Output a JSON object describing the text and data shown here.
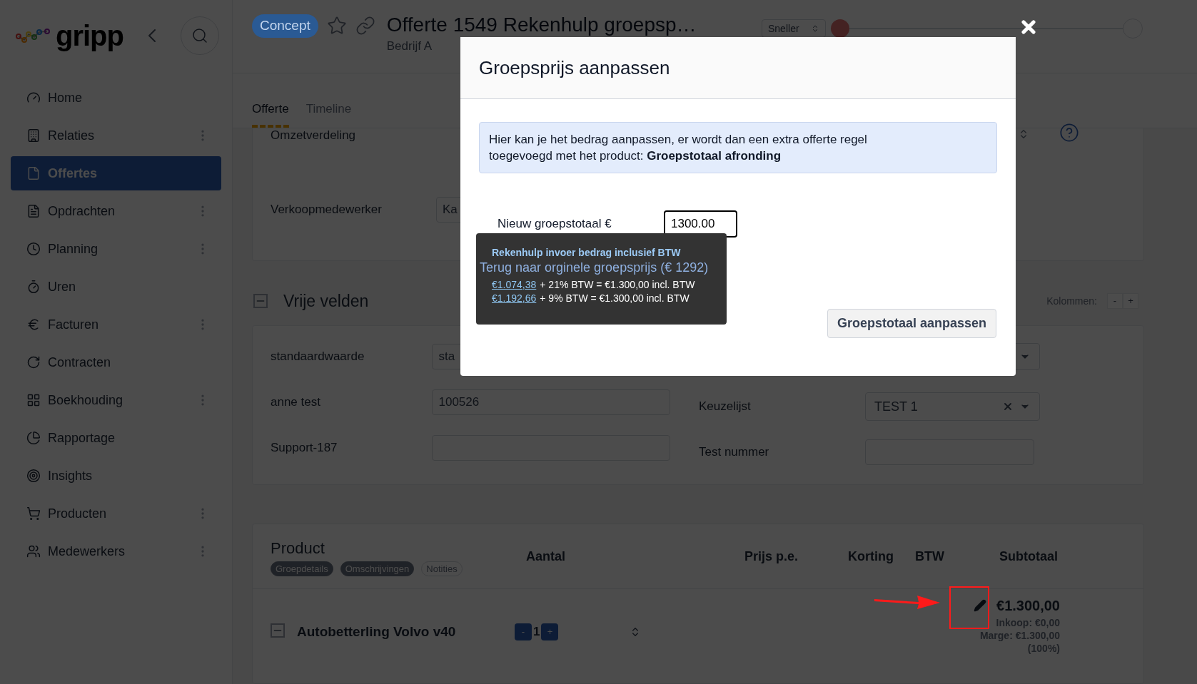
{
  "logo": {
    "text": "gripp"
  },
  "sidebar": {
    "items": [
      {
        "label": "Home",
        "selected": false,
        "menu": false
      },
      {
        "label": "Relaties",
        "selected": false,
        "menu": true
      },
      {
        "label": "Offertes",
        "selected": true,
        "menu": false
      },
      {
        "label": "Opdrachten",
        "selected": false,
        "menu": true
      },
      {
        "label": "Planning",
        "selected": false,
        "menu": true
      },
      {
        "label": "Uren",
        "selected": false,
        "menu": false
      },
      {
        "label": "Facturen",
        "selected": false,
        "menu": true
      },
      {
        "label": "Contracten",
        "selected": false,
        "menu": false
      },
      {
        "label": "Boekhouding",
        "selected": false,
        "menu": true
      },
      {
        "label": "Rapportage",
        "selected": false,
        "menu": false
      },
      {
        "label": "Insights",
        "selected": false,
        "menu": false
      },
      {
        "label": "Producten",
        "selected": false,
        "menu": true
      },
      {
        "label": "Medewerkers",
        "selected": false,
        "menu": true
      }
    ]
  },
  "header": {
    "status": "Concept",
    "title": "Offerte 1549 Rekenhulp groepsp…",
    "company": "Bedrijf A",
    "speed_select": "Sneller",
    "slider": {
      "level": 0
    }
  },
  "tabs": [
    {
      "label": "Offerte",
      "selected": true
    },
    {
      "label": "Timeline",
      "selected": false
    }
  ],
  "details": {
    "fields": [
      {
        "label": "Omzetverdeling"
      },
      {
        "label": "Verkoopmedewerker",
        "value": "Ka"
      }
    ]
  },
  "free_fields": {
    "title": "Vrije velden",
    "columns_label": "Kolommen:",
    "minus": "-",
    "plus": "+",
    "left": [
      {
        "label": "standaardwaarde",
        "value": "sta"
      },
      {
        "label": "anne test",
        "value": "100526"
      },
      {
        "label": "Support-187"
      }
    ],
    "right": [
      {
        "label": "Keuzelijst",
        "kind": "select",
        "value": "TEST 1"
      },
      {
        "label": "Test nummer",
        "kind": "input"
      }
    ]
  },
  "products": {
    "title": "Product",
    "chips": [
      {
        "label": "Groepdetails",
        "on": true
      },
      {
        "label": "Omschrijvingen",
        "on": true
      },
      {
        "label": "Notities",
        "on": false
      }
    ],
    "columns": [
      "Aantal",
      "Prijs p.e.",
      "Korting",
      "BTW",
      "Subtotaal"
    ],
    "rows": [
      {
        "name": "Autobetterling Volvo v40",
        "minus": "-",
        "quantity": "1",
        "plus": "+",
        "subtotal": "€1.300,00",
        "purchase": "Inkoop: €0,00",
        "margin": "Marge: €1.300,00",
        "margin_pct": "(100%)"
      }
    ]
  },
  "modal": {
    "title": "Groepsprijs aanpassen",
    "info": "Hier kan je het bedrag aanpassen, er wordt dan een extra offerte regel toegevoegd met het product: **Groepstotaal afronding**",
    "field_label": "Nieuw groepstotaal €",
    "field_value": "1300.00",
    "reset_link": "Terug naar orginele groepsprijs (€ 1292)",
    "button": "Groepstotaal aanpassen",
    "tooltip": {
      "title": "Rekenhulp invoer bedrag inclusief BTW",
      "lines": [
        {
          "amount": "€1.074,38",
          "text": "+ 21% BTW = €1.300,00 incl. BTW"
        },
        {
          "amount": "€1.192,66",
          "text": "+ 9% BTW = €1.300,00 incl. BTW"
        }
      ]
    }
  }
}
